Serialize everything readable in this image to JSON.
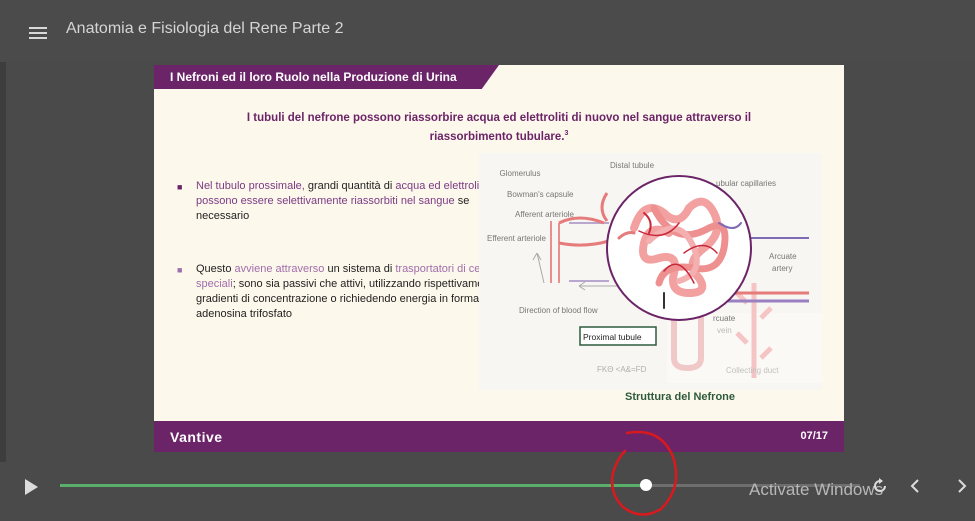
{
  "app": {
    "title": "Anatomia e Fisiologia del Rene Parte 2"
  },
  "slide": {
    "header": "I Nefroni ed il loro Ruolo nella Produzione di Urina",
    "subtitle": "I tubuli del nefrone possono riassorbire acqua ed elettroliti di nuovo nel sangue attraverso il riassorbimento tubulare.",
    "subtitle_ref": "3",
    "bullet1": {
      "p1": "Nel tubulo prossimale,",
      "p2": " grandi quantità di ",
      "p3": "acqua ed elettroliti possono essere selettivamente riassorbiti nel sangue",
      "p4": " se necessario"
    },
    "bullet2": {
      "p1": "Questo ",
      "p2": "avviene attraverso",
      "p3": " un sistema di ",
      "p4": "trasportatori di cellule speciali",
      "p5": "; sono sia passivi che attivi, utilizzando rispettivamente gradienti di concentrazione o richiedendo energia in forma di adenosina trifosfato"
    },
    "diagram": {
      "labels": {
        "glomerulus": "Glomerulus",
        "distal_tubule": "Distal tubule",
        "bowmans_capsule": "Bowman's capsule",
        "peritubular": "ubular capillaries",
        "afferent": "Afferent arteriole",
        "efferent": "Efferent arteriole",
        "arcuate_artery_1": "Arcuate",
        "arcuate_artery_2": "artery",
        "blood_flow": "Direction of blood flow",
        "arcuate_vein_1": "rcuate",
        "arcuate_vein_2": "vein",
        "proximal_tubule": "Proximal tubule",
        "garbled": "FKΘ <A&=FD",
        "collecting_duct": "Collecting duct"
      }
    },
    "caption": "Struttura del Nefrone",
    "logo": "Vantive",
    "page": "07/17"
  },
  "player": {
    "progress": 0.7325,
    "watermark": "Activate Windows"
  },
  "colors": {
    "brand_purple": "#6b2467",
    "progress_green": "#5ab06a",
    "annotation_red": "#d8191e"
  }
}
